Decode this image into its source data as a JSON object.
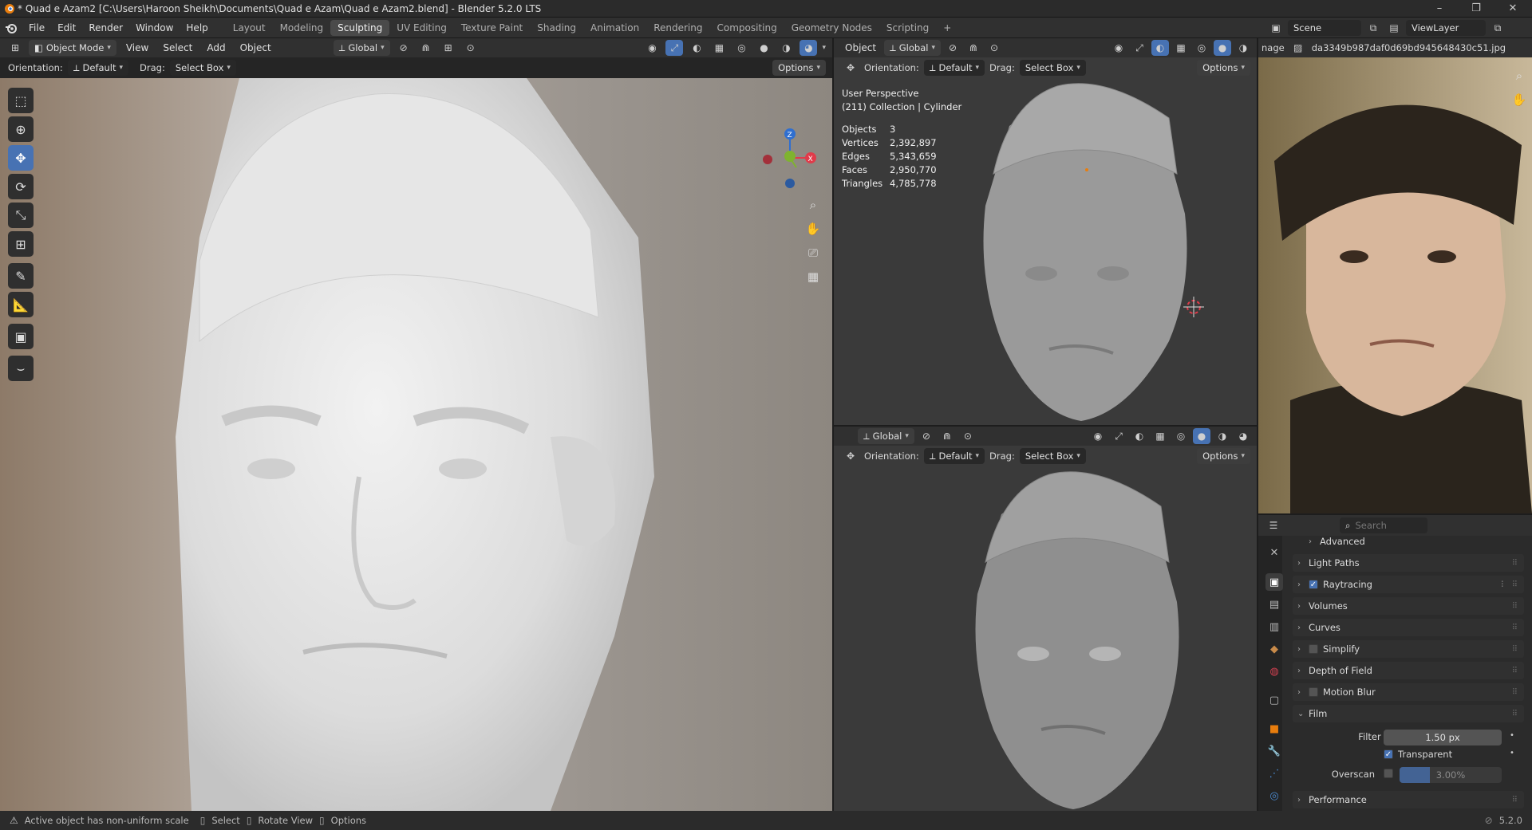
{
  "window": {
    "title": "* Quad e Azam2 [C:\\Users\\Haroon Sheikh\\Documents\\Quad e Azam\\Quad e Azam2.blend] - Blender 5.2.0 LTS",
    "controls": [
      "–",
      "❐",
      "✕"
    ]
  },
  "menu": [
    "File",
    "Edit",
    "Render",
    "Window",
    "Help"
  ],
  "workspaces": {
    "tabs": [
      "Layout",
      "Modeling",
      "Sculpting",
      "UV Editing",
      "Texture Paint",
      "Shading",
      "Animation",
      "Rendering",
      "Compositing",
      "Geometry Nodes",
      "Scripting"
    ],
    "active": "Sculpting",
    "add": "+"
  },
  "scene": {
    "name": "Scene",
    "view_layer": "ViewLayer"
  },
  "viewport_main": {
    "mode": "Object Mode",
    "menus": [
      "View",
      "Select",
      "Add",
      "Object"
    ],
    "transform": "Global",
    "orientation_label": "Orientation:",
    "orientation_value": "Default",
    "drag_label": "Drag:",
    "drag_value": "Select Box",
    "options": "Options"
  },
  "viewport_top": {
    "object_menu": "Object",
    "transform": "Global",
    "orientation_label": "Orientation:",
    "orientation_value": "Default",
    "drag_label": "Drag:",
    "drag_value": "Select Box",
    "options": "Options",
    "overlay_line1": "User Perspective",
    "overlay_line2": "(211) Collection | Cylinder",
    "stats": [
      {
        "label": "Objects",
        "value": "3"
      },
      {
        "label": "Vertices",
        "value": "2,392,897"
      },
      {
        "label": "Edges",
        "value": "5,343,659"
      },
      {
        "label": "Faces",
        "value": "2,950,770"
      },
      {
        "label": "Triangles",
        "value": "4,785,778"
      }
    ]
  },
  "viewport_bottom": {
    "transform": "Global",
    "orientation_label": "Orientation:",
    "orientation_value": "Default",
    "drag_label": "Drag:",
    "drag_value": "Select Box",
    "options": "Options"
  },
  "image_editor": {
    "menu": "nage",
    "image_name": "da3349b987daf0d69bd945648430c51.jpg"
  },
  "gizmo": {
    "z": "Z",
    "x": "X"
  },
  "properties": {
    "search_placeholder": "Search",
    "sections": [
      {
        "label": "Advanced",
        "indent": true
      },
      {
        "label": "Light Paths"
      },
      {
        "label": "Raytracing",
        "checkbox": true,
        "checked": true
      },
      {
        "label": "Volumes"
      },
      {
        "label": "Curves"
      },
      {
        "label": "Simplify",
        "checkbox": true,
        "checked": false
      },
      {
        "label": "Depth of Field"
      },
      {
        "label": "Motion Blur",
        "checkbox": true,
        "checked": false
      },
      {
        "label": "Film",
        "open": true
      }
    ],
    "film": {
      "filter_size_label": "Filter Size",
      "filter_size_value": "1.50 px",
      "transparent_label": "Transparent",
      "transparent_checked": true,
      "overscan_label": "Overscan",
      "overscan_value": "3.00%",
      "overscan_fill": 0.3
    },
    "performance": "Performance"
  },
  "statusbar": {
    "warning": "Active object has non-uniform scale",
    "select": "Select",
    "rotate": "Rotate View",
    "options": "Options",
    "version": "5.2.0"
  },
  "colors": {
    "accent": "#4772b3",
    "axis_z": "#2f6fd0",
    "axis_x": "#e03b4a",
    "axis_y": "#7fb32f"
  }
}
